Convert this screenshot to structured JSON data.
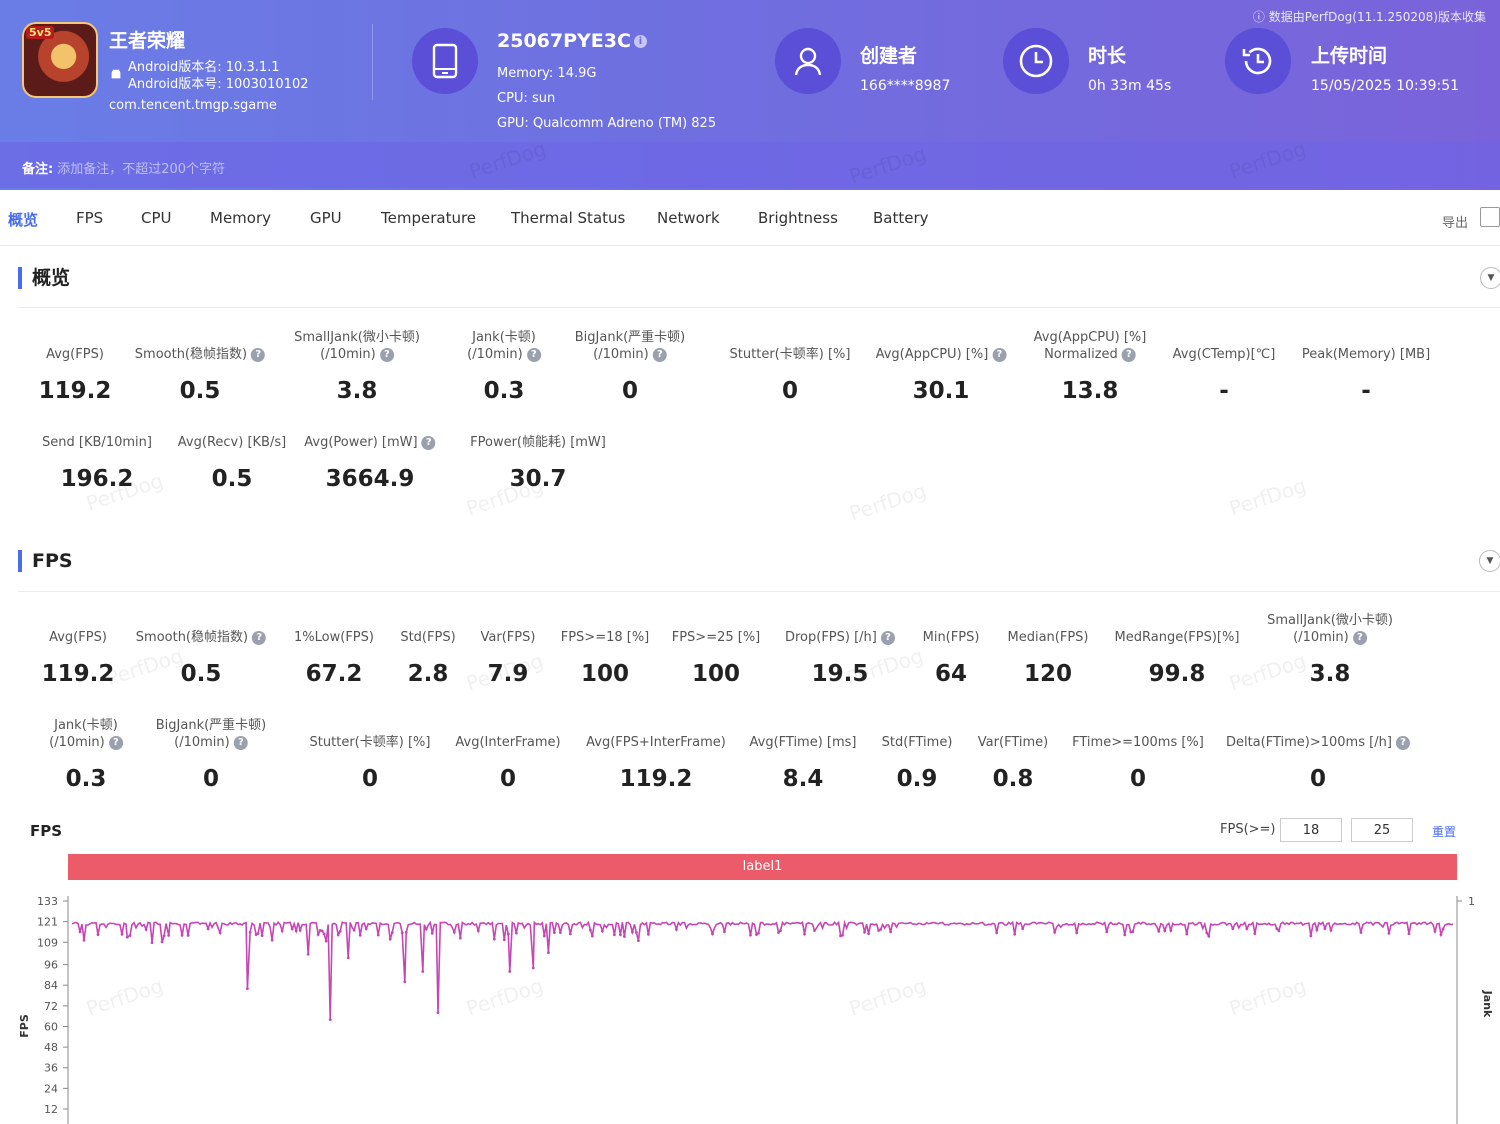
{
  "header": {
    "notice": "ⓘ 数据由PerfDog(11.1.250208)版本收集",
    "app": {
      "icon_badge": "5v5",
      "name": "王者荣耀",
      "version_name": "Android版本名: 10.3.1.1",
      "version_code": "Android版本号: 1003010102",
      "package": "com.tencent.tmgp.sgame"
    },
    "device": {
      "model": "25067PYE3C",
      "info_glyph": "i",
      "memory": "Memory: 14.9G",
      "cpu": "CPU: sun",
      "gpu": "GPU: Qualcomm Adreno (TM) 825"
    },
    "creator": {
      "title": "创建者",
      "value": "166****8987"
    },
    "duration": {
      "title": "时长",
      "value": "0h 33m 45s"
    },
    "upload": {
      "title": "上传时间",
      "value": "15/05/2025 10:39:51"
    },
    "remark_label": "备注:",
    "remark_placeholder": "添加备注，不超过200个字符"
  },
  "tabs": [
    "概览",
    "FPS",
    "CPU",
    "Memory",
    "GPU",
    "Temperature",
    "Thermal Status",
    "Network",
    "Brightness",
    "Battery"
  ],
  "export_label": "导出",
  "overview": {
    "title": "概览",
    "row1": [
      {
        "label": "Avg(FPS)",
        "value": "119.2"
      },
      {
        "label": "Smooth(稳帧指数)",
        "value": "0.5",
        "help": true
      },
      {
        "label": "SmallJank(微小卡顿)",
        "label2": "(/10min)",
        "value": "3.8",
        "help": true
      },
      {
        "label": "Jank(卡顿)",
        "label2": "(/10min)",
        "value": "0.3",
        "help": true
      },
      {
        "label": "BigJank(严重卡顿)",
        "label2": "(/10min)",
        "value": "0",
        "help": true
      },
      {
        "label": "Stutter(卡顿率) [%]",
        "value": "0"
      },
      {
        "label": "Avg(AppCPU) [%]",
        "value": "30.1",
        "help": true
      },
      {
        "label": "Avg(AppCPU) [%]",
        "label2": "Normalized",
        "value": "13.8",
        "help": true
      },
      {
        "label": "Avg(CTemp)[℃]",
        "value": "-"
      },
      {
        "label": "Peak(Memory) [MB]",
        "value": "-"
      }
    ],
    "row2": [
      {
        "label": "Send [KB/10min]",
        "value": "196.2"
      },
      {
        "label": "Avg(Recv) [KB/s]",
        "value": "0.5"
      },
      {
        "label": "Avg(Power) [mW]",
        "value": "3664.9",
        "help": true
      },
      {
        "label": "FPower(帧能耗) [mW]",
        "value": "30.7"
      }
    ]
  },
  "fps_section": {
    "title": "FPS",
    "row1": [
      {
        "label": "Avg(FPS)",
        "value": "119.2"
      },
      {
        "label": "Smooth(稳帧指数)",
        "value": "0.5",
        "help": true
      },
      {
        "label": "1%Low(FPS)",
        "value": "67.2"
      },
      {
        "label": "Std(FPS)",
        "value": "2.8"
      },
      {
        "label": "Var(FPS)",
        "value": "7.9"
      },
      {
        "label": "FPS>=18 [%]",
        "value": "100"
      },
      {
        "label": "FPS>=25 [%]",
        "value": "100"
      },
      {
        "label": "Drop(FPS) [/h]",
        "value": "19.5",
        "help": true
      },
      {
        "label": "Min(FPS)",
        "value": "64"
      },
      {
        "label": "Median(FPS)",
        "value": "120"
      },
      {
        "label": "MedRange(FPS)[%]",
        "value": "99.8"
      },
      {
        "label": "SmallJank(微小卡顿)",
        "label2": "(/10min)",
        "value": "3.8",
        "help": true
      }
    ],
    "row2": [
      {
        "label": "Jank(卡顿)",
        "label2": "(/10min)",
        "value": "0.3",
        "help": true
      },
      {
        "label": "BigJank(严重卡顿)",
        "label2": "(/10min)",
        "value": "0",
        "help": true
      },
      {
        "label": "Stutter(卡顿率) [%]",
        "value": "0"
      },
      {
        "label": "Avg(InterFrame)",
        "value": "0"
      },
      {
        "label": "Avg(FPS+InterFrame)",
        "value": "119.2"
      },
      {
        "label": "Avg(FTime) [ms]",
        "value": "8.4"
      },
      {
        "label": "Std(FTime)",
        "value": "0.9"
      },
      {
        "label": "Var(FTime)",
        "value": "0.8"
      },
      {
        "label": "FTime>=100ms [%]",
        "value": "0"
      },
      {
        "label": "Delta(FTime)>100ms [/h]",
        "value": "0",
        "help": true
      }
    ],
    "chart_title": "FPS",
    "threshold_label": "FPS(>=)",
    "threshold_1": "18",
    "threshold_2": "25",
    "reset_label": "重置",
    "band_label": "label1"
  },
  "watermark": "PerfDog",
  "colors": {
    "accent": "#4a6cf0",
    "series": "#c447b5",
    "band": "#ec5b6a"
  },
  "chart_data": {
    "type": "line",
    "ylabel": "FPS",
    "y2label": "Jank",
    "y_ticks": [
      12,
      24,
      36,
      48,
      60,
      72,
      84,
      96,
      109,
      121,
      133
    ],
    "y2_ticks": [
      1
    ],
    "ylim": [
      0,
      133
    ],
    "series": [
      {
        "baseline": 120,
        "dips": [
          {
            "t": 0.127,
            "fps": 82
          },
          {
            "t": 0.187,
            "fps": 64
          },
          {
            "t": 0.171,
            "fps": 102
          },
          {
            "t": 0.2,
            "fps": 100
          },
          {
            "t": 0.241,
            "fps": 86
          },
          {
            "t": 0.254,
            "fps": 92
          },
          {
            "t": 0.265,
            "fps": 68
          },
          {
            "t": 0.317,
            "fps": 92
          },
          {
            "t": 0.334,
            "fps": 94
          },
          {
            "t": 0.345,
            "fps": 103
          },
          {
            "t": 0.04,
            "fps": 112
          },
          {
            "t": 0.07,
            "fps": 113
          }
        ]
      }
    ],
    "grid": false
  }
}
